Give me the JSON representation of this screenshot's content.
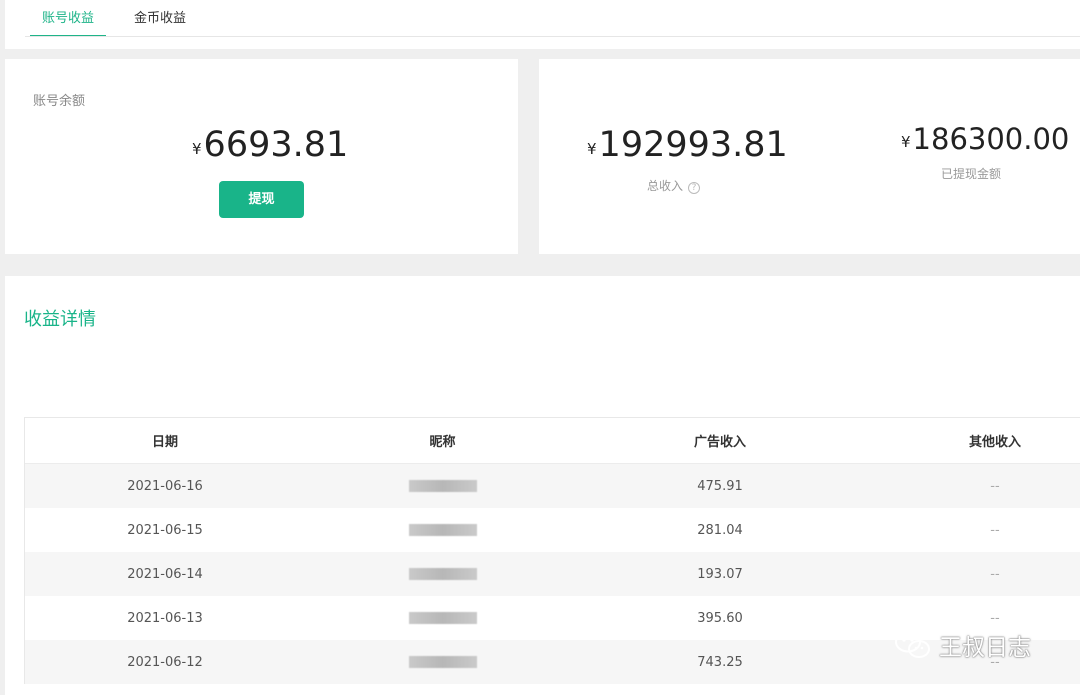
{
  "tabs": [
    {
      "label": "账号收益",
      "active": true
    },
    {
      "label": "金币收益",
      "active": false
    }
  ],
  "balance": {
    "label": "账号余额",
    "currency": "¥",
    "amount": "6693.81",
    "withdraw_label": "提现"
  },
  "income": {
    "currency": "¥",
    "total_amount": "192993.81",
    "total_label": "总收入",
    "withdrawn_amount": "186300.00",
    "withdrawn_label": "已提现金额"
  },
  "details": {
    "title": "收益详情",
    "columns": [
      "日期",
      "昵称",
      "广告收入",
      "其他收入"
    ],
    "rows": [
      {
        "date": "2021-06-16",
        "ad_income": "475.91",
        "other_income": "--"
      },
      {
        "date": "2021-06-15",
        "ad_income": "281.04",
        "other_income": "--"
      },
      {
        "date": "2021-06-14",
        "ad_income": "193.07",
        "other_income": "--"
      },
      {
        "date": "2021-06-13",
        "ad_income": "395.60",
        "other_income": "--"
      },
      {
        "date": "2021-06-12",
        "ad_income": "743.25",
        "other_income": "--"
      }
    ]
  },
  "watermark": {
    "text": "王叔日志",
    "icon": "wechat-icon"
  },
  "colors": {
    "accent": "#19b489",
    "background": "#efefef"
  }
}
